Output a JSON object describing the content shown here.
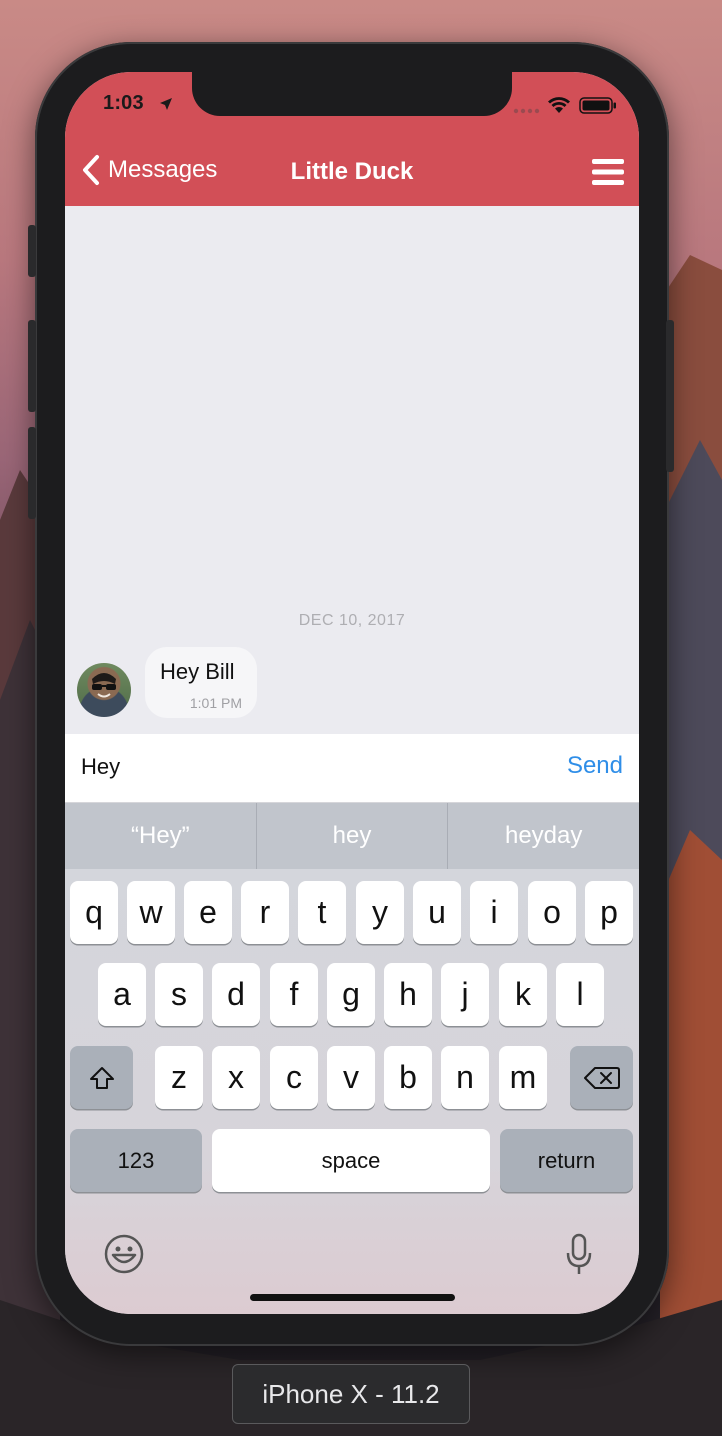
{
  "status": {
    "time": "1:03"
  },
  "nav": {
    "back_label": "Messages",
    "title": "Little Duck"
  },
  "chat": {
    "date_separator": "DEC 10, 2017",
    "messages": [
      {
        "text": "Hey Bill",
        "time": "1:01 PM"
      }
    ]
  },
  "composer": {
    "value": "Hey",
    "send_label": "Send"
  },
  "keyboard": {
    "predictions": [
      "“Hey”",
      "hey",
      "heyday"
    ],
    "row1": [
      "q",
      "w",
      "e",
      "r",
      "t",
      "y",
      "u",
      "i",
      "o",
      "p"
    ],
    "row2": [
      "a",
      "s",
      "d",
      "f",
      "g",
      "h",
      "j",
      "k",
      "l"
    ],
    "row3": [
      "z",
      "x",
      "c",
      "v",
      "b",
      "n",
      "m"
    ],
    "numbers_label": "123",
    "space_label": "space",
    "return_label": "return"
  },
  "simulator": {
    "label": "iPhone X - 11.2"
  },
  "colors": {
    "nav": "#d24f57",
    "accent": "#2f8ee8"
  },
  "icons": [
    "location-arrow-icon",
    "signal-dots-icon",
    "wifi-icon",
    "battery-icon",
    "chevron-left-icon",
    "menu-icon",
    "shift-icon",
    "backspace-icon",
    "emoji-icon",
    "microphone-icon"
  ]
}
